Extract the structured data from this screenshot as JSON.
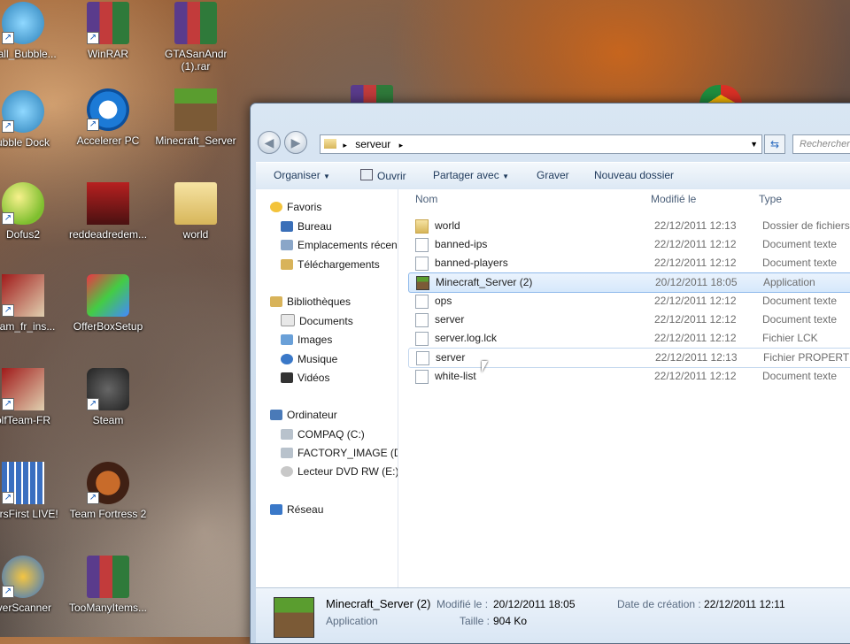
{
  "desktop": {
    "icons": [
      {
        "label": "stall_Bubble...",
        "icon": "bubble-app-icon"
      },
      {
        "label": "WinRAR",
        "icon": "winrar-icon"
      },
      {
        "label": "GTASanAndreas (1).rar",
        "icon": "rar-archive-icon"
      },
      {
        "label": "ubble Dock",
        "icon": "bubble-dock-icon"
      },
      {
        "label": "Accelerer PC",
        "icon": "accelerer-pc-icon"
      },
      {
        "label": "Minecraft_Server",
        "icon": "minecraft-icon"
      },
      {
        "label": "Dofus2",
        "icon": "dofus-egg-icon"
      },
      {
        "label": "reddeadredem...",
        "icon": "red-dead-icon"
      },
      {
        "label": "world",
        "icon": "folder-icon"
      },
      {
        "label": "team_fr_ins...",
        "icon": "wolfteam-installer-icon"
      },
      {
        "label": "OfferBoxSetup",
        "icon": "offerbox-icon"
      },
      {
        "label": "olfTeam-FR",
        "icon": "wolfteam-icon"
      },
      {
        "label": "Steam",
        "icon": "steam-icon"
      },
      {
        "label": "nersFirst LIVE!",
        "icon": "gamersfirst-icon"
      },
      {
        "label": "Team Fortress 2",
        "icon": "tf2-icon"
      },
      {
        "label": "iverScanner",
        "icon": "driverscanner-icon"
      },
      {
        "label": "TooManyItems...",
        "icon": "rar-archive-icon"
      }
    ]
  },
  "window": {
    "address": "serveur",
    "search_placeholder": "Rechercher",
    "toolbar": {
      "organiser": "Organiser",
      "ouvrir": "Ouvrir",
      "partager": "Partager avec",
      "graver": "Graver",
      "nouveau_dossier": "Nouveau dossier"
    },
    "nav": {
      "favoris": "Favoris",
      "bureau": "Bureau",
      "emplacements": "Emplacements récen",
      "telechargements": "Téléchargements",
      "bibliotheques": "Bibliothèques",
      "documents": "Documents",
      "images": "Images",
      "musique": "Musique",
      "videos": "Vidéos",
      "ordinateur": "Ordinateur",
      "compaq": "COMPAQ (C:)",
      "factory": "FACTORY_IMAGE (D",
      "dvd": "Lecteur DVD RW (E:)",
      "reseau": "Réseau"
    },
    "columns": {
      "nom": "Nom",
      "modifie": "Modifié le",
      "type": "Type"
    },
    "files": [
      {
        "name": "world",
        "date": "22/12/2011 12:13",
        "type": "Dossier de fichiers",
        "icon": "folder"
      },
      {
        "name": "banned-ips",
        "date": "22/12/2011 12:12",
        "type": "Document texte",
        "icon": "text"
      },
      {
        "name": "banned-players",
        "date": "22/12/2011 12:12",
        "type": "Document texte",
        "icon": "text"
      },
      {
        "name": "Minecraft_Server (2)",
        "date": "20/12/2011 18:05",
        "type": "Application",
        "icon": "app"
      },
      {
        "name": "ops",
        "date": "22/12/2011 12:12",
        "type": "Document texte",
        "icon": "text"
      },
      {
        "name": "server",
        "date": "22/12/2011 12:12",
        "type": "Document texte",
        "icon": "text"
      },
      {
        "name": "server.log.lck",
        "date": "22/12/2011 12:12",
        "type": "Fichier LCK",
        "icon": "text"
      },
      {
        "name": "server",
        "date": "22/12/2011 12:13",
        "type": "Fichier PROPERTIES",
        "icon": "text"
      },
      {
        "name": "white-list",
        "date": "22/12/2011 12:12",
        "type": "Document texte",
        "icon": "text"
      }
    ],
    "details": {
      "name": "Minecraft_Server (2)",
      "kind": "Application",
      "modified_label": "Modifié le :",
      "modified_value": "20/12/2011 18:05",
      "size_label": "Taille :",
      "size_value": "904 Ko",
      "created_label": "Date de création :",
      "created_value": "22/12/2011 12:11"
    }
  }
}
